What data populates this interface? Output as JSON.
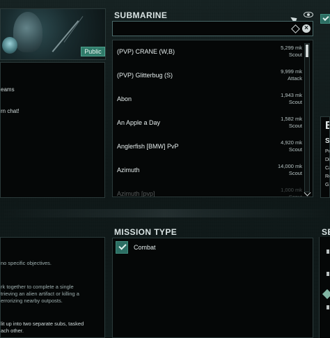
{
  "headers": {
    "submarine": "SUBMARINE",
    "mission_type": "MISSION TYPE",
    "right_partial": "SE"
  },
  "badges": {
    "public": "Public"
  },
  "chat_lines": [
    "eams",
    "rn chat!"
  ],
  "submarine_list": [
    {
      "name": "(PVP) CRANE (W,B)",
      "distance": "5,299 mk",
      "class": "Scout"
    },
    {
      "name": "(PVP) Glitterbug (S)",
      "distance": "9,999 mk",
      "class": "Attack"
    },
    {
      "name": "Abon",
      "distance": "1,943 mk",
      "class": "Scout"
    },
    {
      "name": "An Apple a Day",
      "distance": "1,582 mk",
      "class": "Scout"
    },
    {
      "name": "Anglerfish [BMW] PvP",
      "distance": "4,920 mk",
      "class": "Scout"
    },
    {
      "name": "Azimuth",
      "distance": "14,000 mk",
      "class": "Scout"
    },
    {
      "name": "Azimuth [pvp]",
      "distance": "1,000 mk",
      "class": "Scout"
    }
  ],
  "right_card": {
    "big": "B",
    "mid": "S",
    "lines": [
      "Pe",
      "Di",
      "Ca",
      "Re",
      "Ga"
    ]
  },
  "mission": {
    "selected_label": "Combat"
  },
  "mission_description_lines": [
    "no specific objectives.",
    "rk together to complete a single",
    "trieving an alien artifact or killing a",
    "errorizing nearby outposts.",
    "lit up into two separate subs, tasked",
    "ach other."
  ],
  "icons": {
    "visibility": "eye-icon",
    "edit": "pencil-icon",
    "clear": "clear-x-icon",
    "scroll_down": "chevron-down-icon",
    "checkbox_checked": "check-icon",
    "pointer": "cursor-icon"
  },
  "colors": {
    "accent_green": "#2c6e63",
    "panel_bg": "#050707",
    "page_bg": "#101818"
  }
}
